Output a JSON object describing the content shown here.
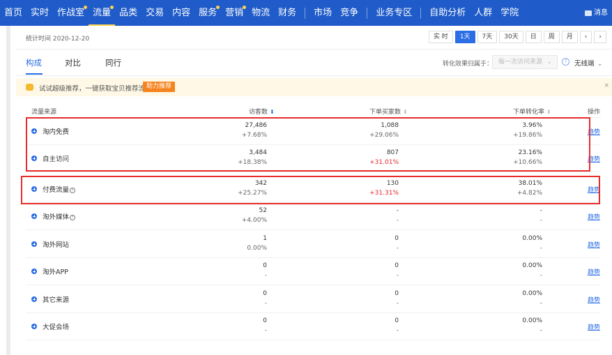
{
  "nav": {
    "items": [
      {
        "label": "首页",
        "dot": false,
        "active": false
      },
      {
        "label": "实时",
        "dot": false,
        "active": false
      },
      {
        "label": "作战室",
        "dot": true,
        "active": false
      },
      {
        "label": "流量",
        "dot": true,
        "active": true
      },
      {
        "label": "品类",
        "dot": false,
        "active": false
      },
      {
        "label": "交易",
        "dot": false,
        "active": false
      },
      {
        "label": "内容",
        "dot": false,
        "active": false
      },
      {
        "label": "服务",
        "dot": true,
        "active": false
      },
      {
        "label": "营销",
        "dot": true,
        "active": false
      },
      {
        "label": "物流",
        "dot": false,
        "active": false
      },
      {
        "label": "财务",
        "dot": false,
        "active": false
      },
      {
        "label": "市场",
        "dot": false,
        "active": false
      },
      {
        "label": "竞争",
        "dot": false,
        "active": false
      },
      {
        "label": "业务专区",
        "dot": false,
        "active": false
      },
      {
        "label": "自助分析",
        "dot": false,
        "active": false
      },
      {
        "label": "人群",
        "dot": false,
        "active": false
      },
      {
        "label": "学院",
        "dot": false,
        "active": false
      }
    ],
    "message": "消息"
  },
  "datebar": {
    "stat_time": "统计时间 2020-12-20",
    "ranges": [
      "实 时",
      "1天",
      "7天",
      "30天",
      "日",
      "周",
      "月"
    ],
    "active_range": "1天",
    "prev": "‹",
    "next": "›"
  },
  "tabs": [
    "构成",
    "对比",
    "同行"
  ],
  "controls": {
    "conv_label": "转化效果归属于：",
    "conv_placeholder": "每一次访问来源",
    "trend_type": "无线端"
  },
  "banner": {
    "text": "试试超级推荐，一键获取宝贝推荐流量",
    "button": "助力推荐",
    "close": "×"
  },
  "table": {
    "headers": {
      "source": "流量来源",
      "visitors": "访客数",
      "buyers": "下单买家数",
      "rate": "下单转化率",
      "action": "操作"
    },
    "link_label": "趋势",
    "rows": [
      {
        "name": "淘内免费",
        "help": false,
        "visitors": "27,486",
        "visitors_change": "+7.68%",
        "visitors_up": false,
        "buyers": "1,088",
        "buyers_change": "+29.06%",
        "buyers_up": false,
        "rate": "3.96%",
        "rate_change": "+19.86%",
        "rate_up": false
      },
      {
        "name": "自主访问",
        "help": false,
        "visitors": "3,484",
        "visitors_change": "+18.38%",
        "visitors_up": false,
        "buyers": "807",
        "buyers_change": "+31.01%",
        "buyers_up": true,
        "rate": "23.16%",
        "rate_change": "+10.66%",
        "rate_up": false
      },
      {
        "name": "付费流量",
        "help": true,
        "visitors": "342",
        "visitors_change": "+25.27%",
        "visitors_up": false,
        "buyers": "130",
        "buyers_change": "+31.31%",
        "buyers_up": true,
        "rate": "38.01%",
        "rate_change": "+4.82%",
        "rate_up": false
      },
      {
        "name": "淘外媒体",
        "help": true,
        "visitors": "52",
        "visitors_change": "+4.00%",
        "visitors_up": false,
        "buyers": "-",
        "buyers_change": "-",
        "buyers_up": false,
        "rate": "-",
        "rate_change": "-",
        "rate_up": false
      },
      {
        "name": "淘外网站",
        "help": false,
        "visitors": "1",
        "visitors_change": "0.00%",
        "visitors_up": false,
        "buyers": "0",
        "buyers_change": "-",
        "buyers_up": false,
        "rate": "0.00%",
        "rate_change": "-",
        "rate_up": false
      },
      {
        "name": "淘外APP",
        "help": false,
        "visitors": "0",
        "visitors_change": "-",
        "visitors_up": false,
        "buyers": "0",
        "buyers_change": "-",
        "buyers_up": false,
        "rate": "0.00%",
        "rate_change": "-",
        "rate_up": false
      },
      {
        "name": "其它来源",
        "help": false,
        "visitors": "0",
        "visitors_change": "-",
        "visitors_up": false,
        "buyers": "0",
        "buyers_change": "-",
        "buyers_up": false,
        "rate": "0.00%",
        "rate_change": "-",
        "rate_up": false
      },
      {
        "name": "大促会场",
        "help": false,
        "visitors": "0",
        "visitors_change": "-",
        "visitors_up": false,
        "buyers": "0",
        "buyers_change": "-",
        "buyers_up": false,
        "rate": "0.00%",
        "rate_change": "-",
        "rate_up": false
      }
    ]
  },
  "colors": {
    "nav_bg": "#1f5bc9",
    "accent": "#2b6de5",
    "up": "#e8262a",
    "highlight_box": "#e82b2b"
  }
}
